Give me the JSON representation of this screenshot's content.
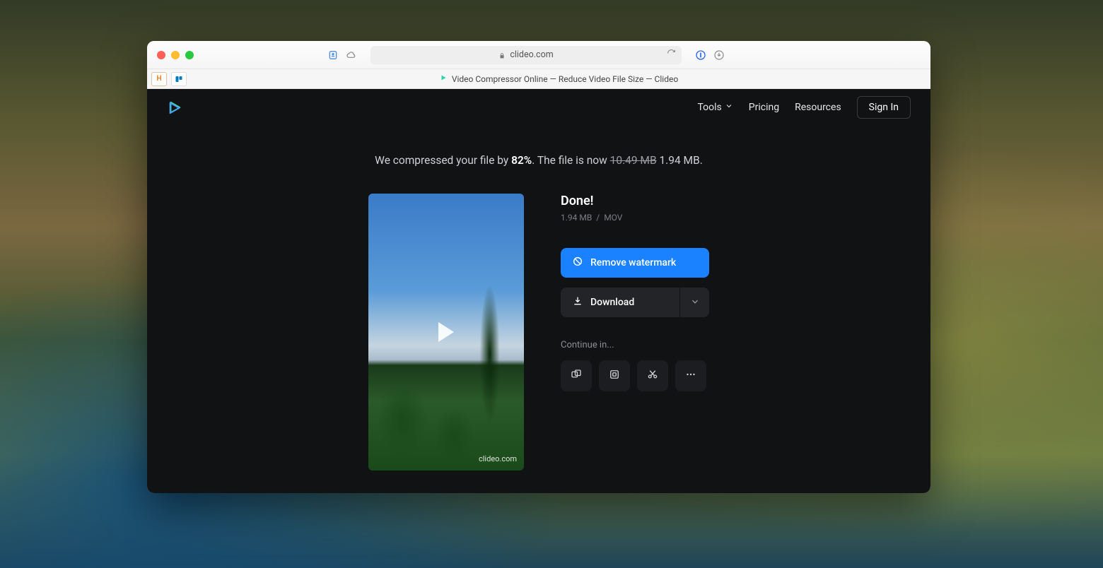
{
  "browser": {
    "url_display": "clideo.com",
    "tab_title": "Video Compressor Online — Reduce Video File Size — Clideo"
  },
  "nav": {
    "tools": "Tools",
    "pricing": "Pricing",
    "resources": "Resources",
    "signin": "Sign In"
  },
  "summary": {
    "prefix": "We compressed your file by ",
    "percent": "82%",
    "mid": ". The file is now ",
    "old_size": "10.49 MB",
    "new_size": "1.94 MB."
  },
  "result": {
    "done": "Done!",
    "file_size": "1.94 MB",
    "separator": "/",
    "format": "MOV",
    "remove_watermark": "Remove watermark",
    "download": "Download",
    "continue_in": "Continue in...",
    "preview_watermark": "clideo.com"
  },
  "colors": {
    "accent": "#1a82ff",
    "page_bg": "#111214",
    "secondary_btn": "#232428"
  }
}
